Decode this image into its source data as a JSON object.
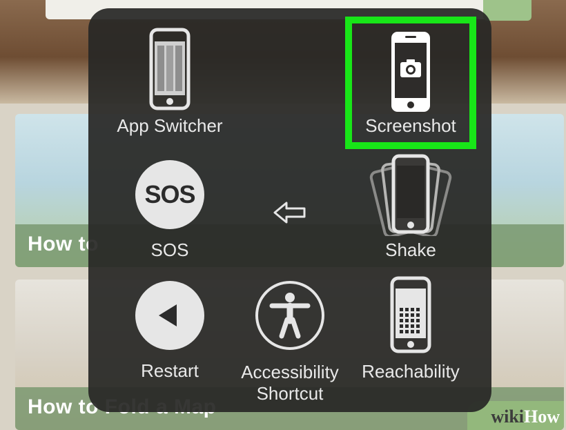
{
  "background": {
    "card1_title": "How to",
    "card2_title": "How to Fold a Map",
    "watermark_prefix": "wiki",
    "watermark_suffix": "How"
  },
  "menu": {
    "items": [
      {
        "label": "App Switcher",
        "icon": "app-switcher-icon"
      },
      {
        "label": "Screenshot",
        "icon": "camera-phone-icon",
        "highlighted": true
      },
      {
        "label": "SOS",
        "icon": "sos-icon",
        "icon_text": "SOS"
      },
      {
        "label": "",
        "icon": "back-arrow-icon"
      },
      {
        "label": "Shake",
        "icon": "shake-phones-icon"
      },
      {
        "label": "Restart",
        "icon": "restart-icon"
      },
      {
        "label_line1": "Accessibility",
        "label_line2": "Shortcut",
        "icon": "accessibility-icon"
      },
      {
        "label": "Reachability",
        "icon": "reachability-icon"
      }
    ]
  },
  "colors": {
    "highlight": "#18e618",
    "panel": "#282826",
    "icon_light": "#e6e6e6"
  }
}
